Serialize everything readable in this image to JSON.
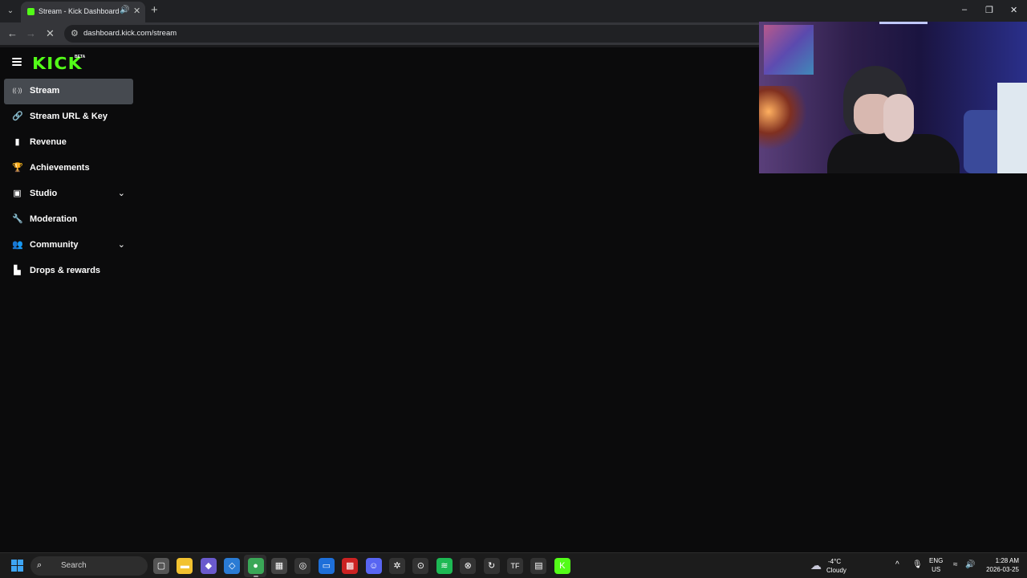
{
  "browser": {
    "tab_title": "Stream - Kick Dashboard",
    "url": "dashboard.kick.com/stream",
    "icons": {
      "tab_menu": "chevron-down-icon",
      "audio": "speaker-icon",
      "close_tab": "close-icon",
      "new_tab": "plus-icon",
      "back": "back-arrow-icon",
      "forward": "forward-arrow-icon",
      "stop": "stop-loading-icon",
      "site_info": "site-info-icon"
    },
    "glyphs": {
      "tab_menu": "⌄",
      "audio": "🔊",
      "close_tab": "✕",
      "new_tab": "+",
      "back": "←",
      "forward": "→",
      "stop": "✕",
      "site_info": "⚙",
      "minimize": "–",
      "maximize": "❐",
      "close_window": "✕"
    }
  },
  "app": {
    "logo": "KICK",
    "logo_badge": "BETA",
    "accent_color": "#53fc18",
    "nav": [
      {
        "label": "Stream",
        "icon": "broadcast-icon",
        "glyph": "((·))",
        "active": true,
        "expandable": false
      },
      {
        "label": "Stream URL & Key",
        "icon": "link-icon",
        "glyph": "🔗",
        "active": false,
        "expandable": false
      },
      {
        "label": "Revenue",
        "icon": "bar-chart-icon",
        "glyph": "▮",
        "active": false,
        "expandable": false
      },
      {
        "label": "Achievements",
        "icon": "trophy-icon",
        "glyph": "🏆",
        "active": false,
        "expandable": false
      },
      {
        "label": "Studio",
        "icon": "studio-icon",
        "glyph": "▣",
        "active": false,
        "expandable": true
      },
      {
        "label": "Moderation",
        "icon": "wrench-icon",
        "glyph": "🔧",
        "active": false,
        "expandable": false
      },
      {
        "label": "Community",
        "icon": "community-icon",
        "glyph": "👥",
        "active": false,
        "expandable": true
      },
      {
        "label": "Drops & rewards",
        "icon": "drops-icon",
        "glyph": "▙",
        "active": false,
        "expandable": false
      }
    ],
    "chevron_glyph": "⌄"
  },
  "taskbar": {
    "search_label": "Search",
    "weather": {
      "temp": "-4°C",
      "condition": "Cloudy"
    },
    "lang": {
      "line1": "ENG",
      "line2": "US"
    },
    "clock": {
      "time": "1:28 AM",
      "date": "2026-03-25"
    },
    "apps": [
      {
        "name": "task-view-icon",
        "glyph": "▢",
        "color": "#555"
      },
      {
        "name": "file-explorer-icon",
        "glyph": "▬",
        "color": "#f2c230"
      },
      {
        "name": "copilot-app-icon",
        "glyph": "◆",
        "color": "#6a5acd"
      },
      {
        "name": "vscode-icon",
        "glyph": "◇",
        "color": "#2a7bd4"
      },
      {
        "name": "chrome-icon",
        "glyph": "●",
        "color": "#3aa757"
      },
      {
        "name": "store-icon",
        "glyph": "▦",
        "color": "#444"
      },
      {
        "name": "obs-icon",
        "glyph": "◎",
        "color": "#333"
      },
      {
        "name": "window-app-icon",
        "glyph": "▭",
        "color": "#1e6fd9"
      },
      {
        "name": "capture-app-icon",
        "glyph": "▩",
        "color": "#c22"
      },
      {
        "name": "discord-icon",
        "glyph": "☺",
        "color": "#5865f2"
      },
      {
        "name": "steelseries-icon",
        "glyph": "✲",
        "color": "#333"
      },
      {
        "name": "steam-icon",
        "glyph": "⊙",
        "color": "#333"
      },
      {
        "name": "spotify-icon",
        "glyph": "≋",
        "color": "#1db954"
      },
      {
        "name": "xbox-icon",
        "glyph": "⊗",
        "color": "#333"
      },
      {
        "name": "sync-icon",
        "glyph": "↻",
        "color": "#333"
      },
      {
        "name": "tf-app-icon",
        "glyph": "TF",
        "color": "#333"
      },
      {
        "name": "gallery-app-icon",
        "glyph": "▤",
        "color": "#333"
      },
      {
        "name": "kick-app-icon",
        "glyph": "K",
        "color": "#53fc18"
      }
    ],
    "tray": {
      "chevron": "^",
      "mic": "🎙",
      "wifi": "≈",
      "volume": "🔊"
    }
  }
}
